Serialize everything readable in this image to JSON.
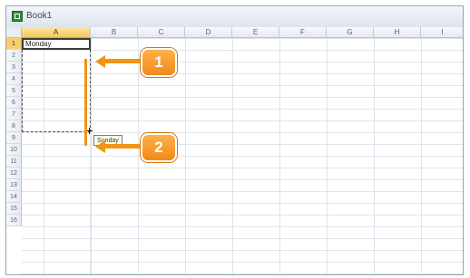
{
  "window": {
    "title": "Book1",
    "app_icon": "excel-sheet-icon"
  },
  "sheet": {
    "columns": [
      "A",
      "B",
      "C",
      "D",
      "E",
      "F",
      "G",
      "H",
      "I"
    ],
    "rows": [
      "1",
      "2",
      "3",
      "4",
      "5",
      "6",
      "7",
      "8",
      "9",
      "10",
      "11",
      "12",
      "13",
      "14",
      "15",
      "16"
    ],
    "selected_column": "A",
    "selected_row": "1",
    "cell_a1": "Monday",
    "autofill_tooltip": "Sunday"
  },
  "callouts": [
    {
      "number": "1"
    },
    {
      "number": "2"
    }
  ],
  "colors": {
    "accent": "#f29416",
    "selection_header": "#f6cf6c",
    "grid_line": "#dfe4ea"
  }
}
